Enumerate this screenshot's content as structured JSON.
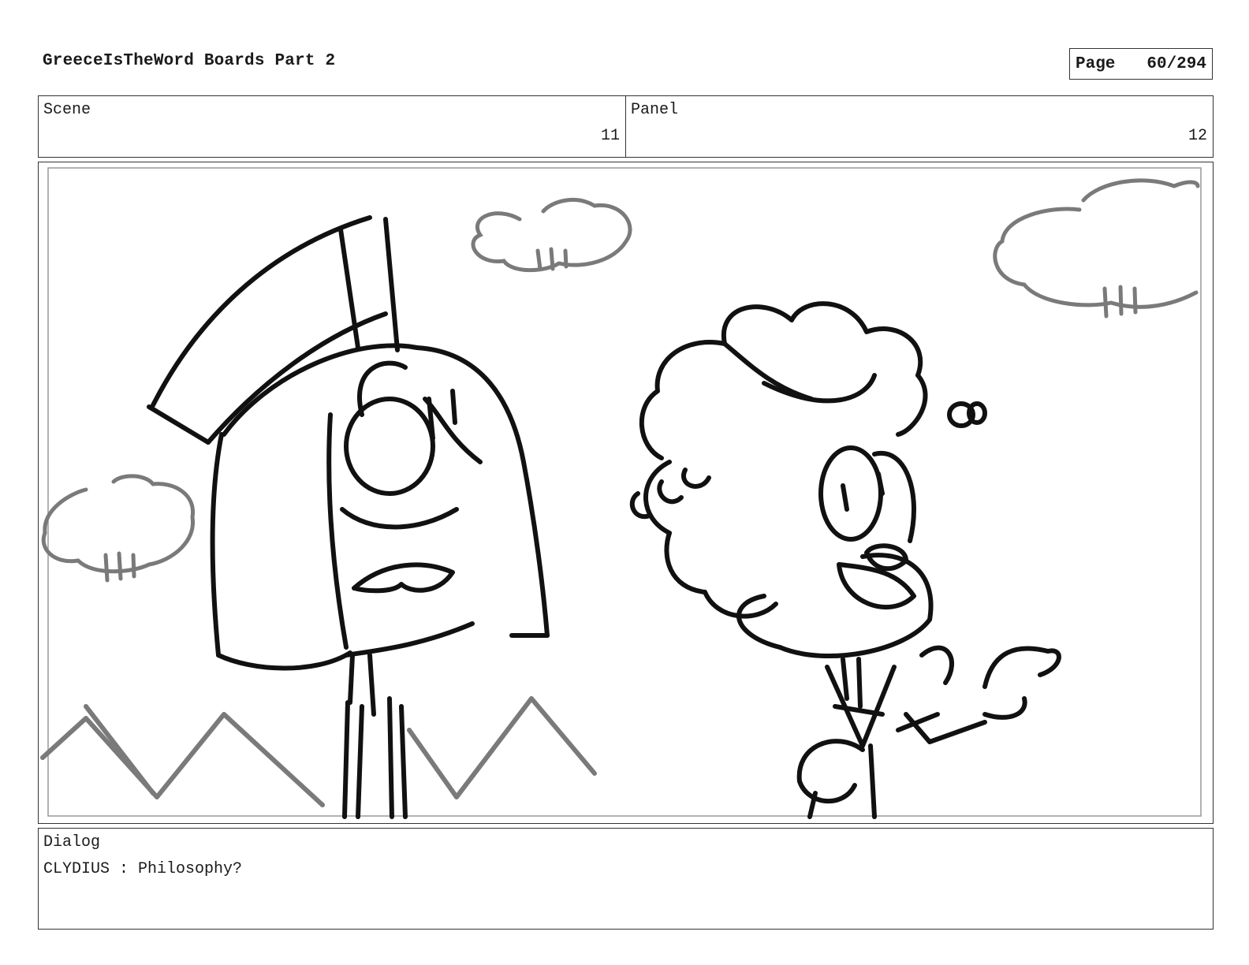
{
  "document": {
    "title": "GreeceIsTheWord Boards Part 2",
    "page_label": "Page",
    "page_number": "60/294"
  },
  "meta": {
    "scene_label": "Scene",
    "scene_number": "11",
    "panel_label": "Panel",
    "panel_number": "12"
  },
  "dialog": {
    "label": "Dialog",
    "line": "CLYDIUS : Philosophy?"
  }
}
